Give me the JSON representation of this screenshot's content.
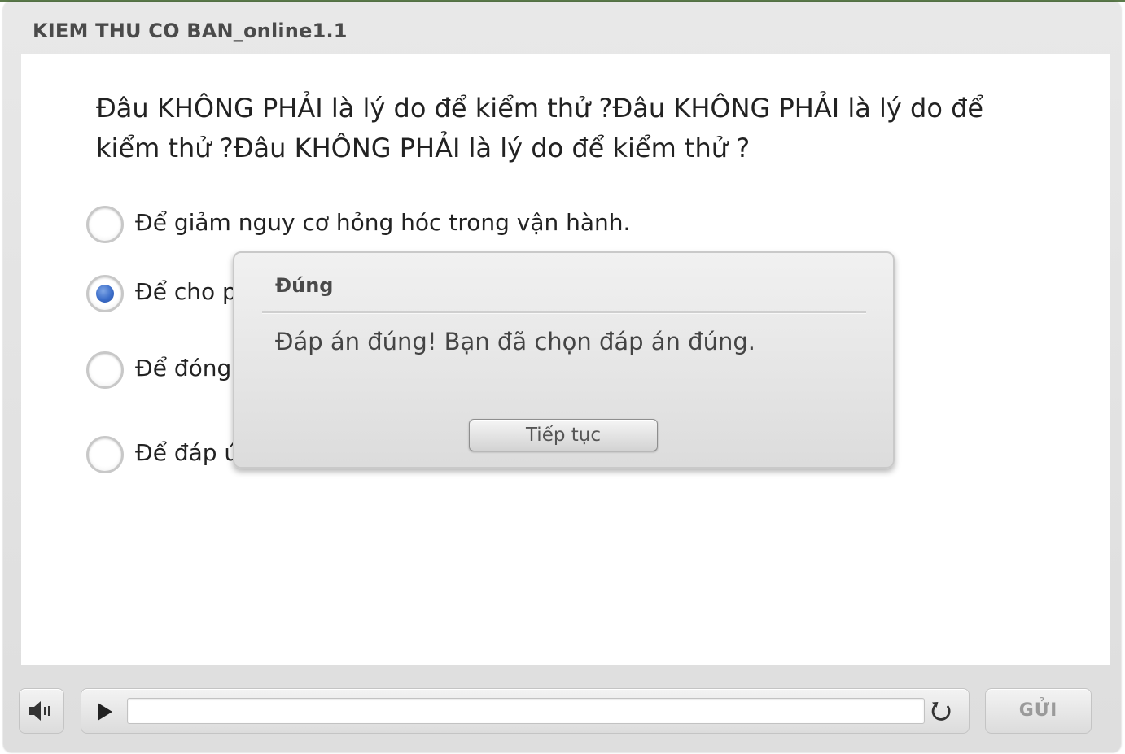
{
  "app": {
    "title": "KIEM THU CO BAN_online1.1"
  },
  "question": {
    "text": "Đâu KHÔNG PHẢI là lý do để kiểm thử ?Đâu KHÔNG PHẢI là lý do để kiểm thử ?Đâu KHÔNG PHẢI là lý do để kiểm thử ?"
  },
  "options": [
    {
      "label": "Để giảm nguy cơ hỏng hóc trong vận hành.",
      "selected": false
    },
    {
      "label": "Để cho p",
      "selected": true
    },
    {
      "label": "Để đóng",
      "selected": false
    },
    {
      "label": "Để đáp ú",
      "selected": false
    }
  ],
  "dialog": {
    "title": "Đúng",
    "message": "Đáp án đúng!  Bạn đã chọn đáp án đúng.",
    "continue_label": "Tiếp tục"
  },
  "toolbar": {
    "volume_icon": "volume-icon",
    "play_icon": "play-icon",
    "replay_icon": "replay-icon",
    "submit_label": "GỬI"
  },
  "colors": {
    "selected_radio": "#3b6dc9",
    "accent_line": "#5b7a4a"
  }
}
